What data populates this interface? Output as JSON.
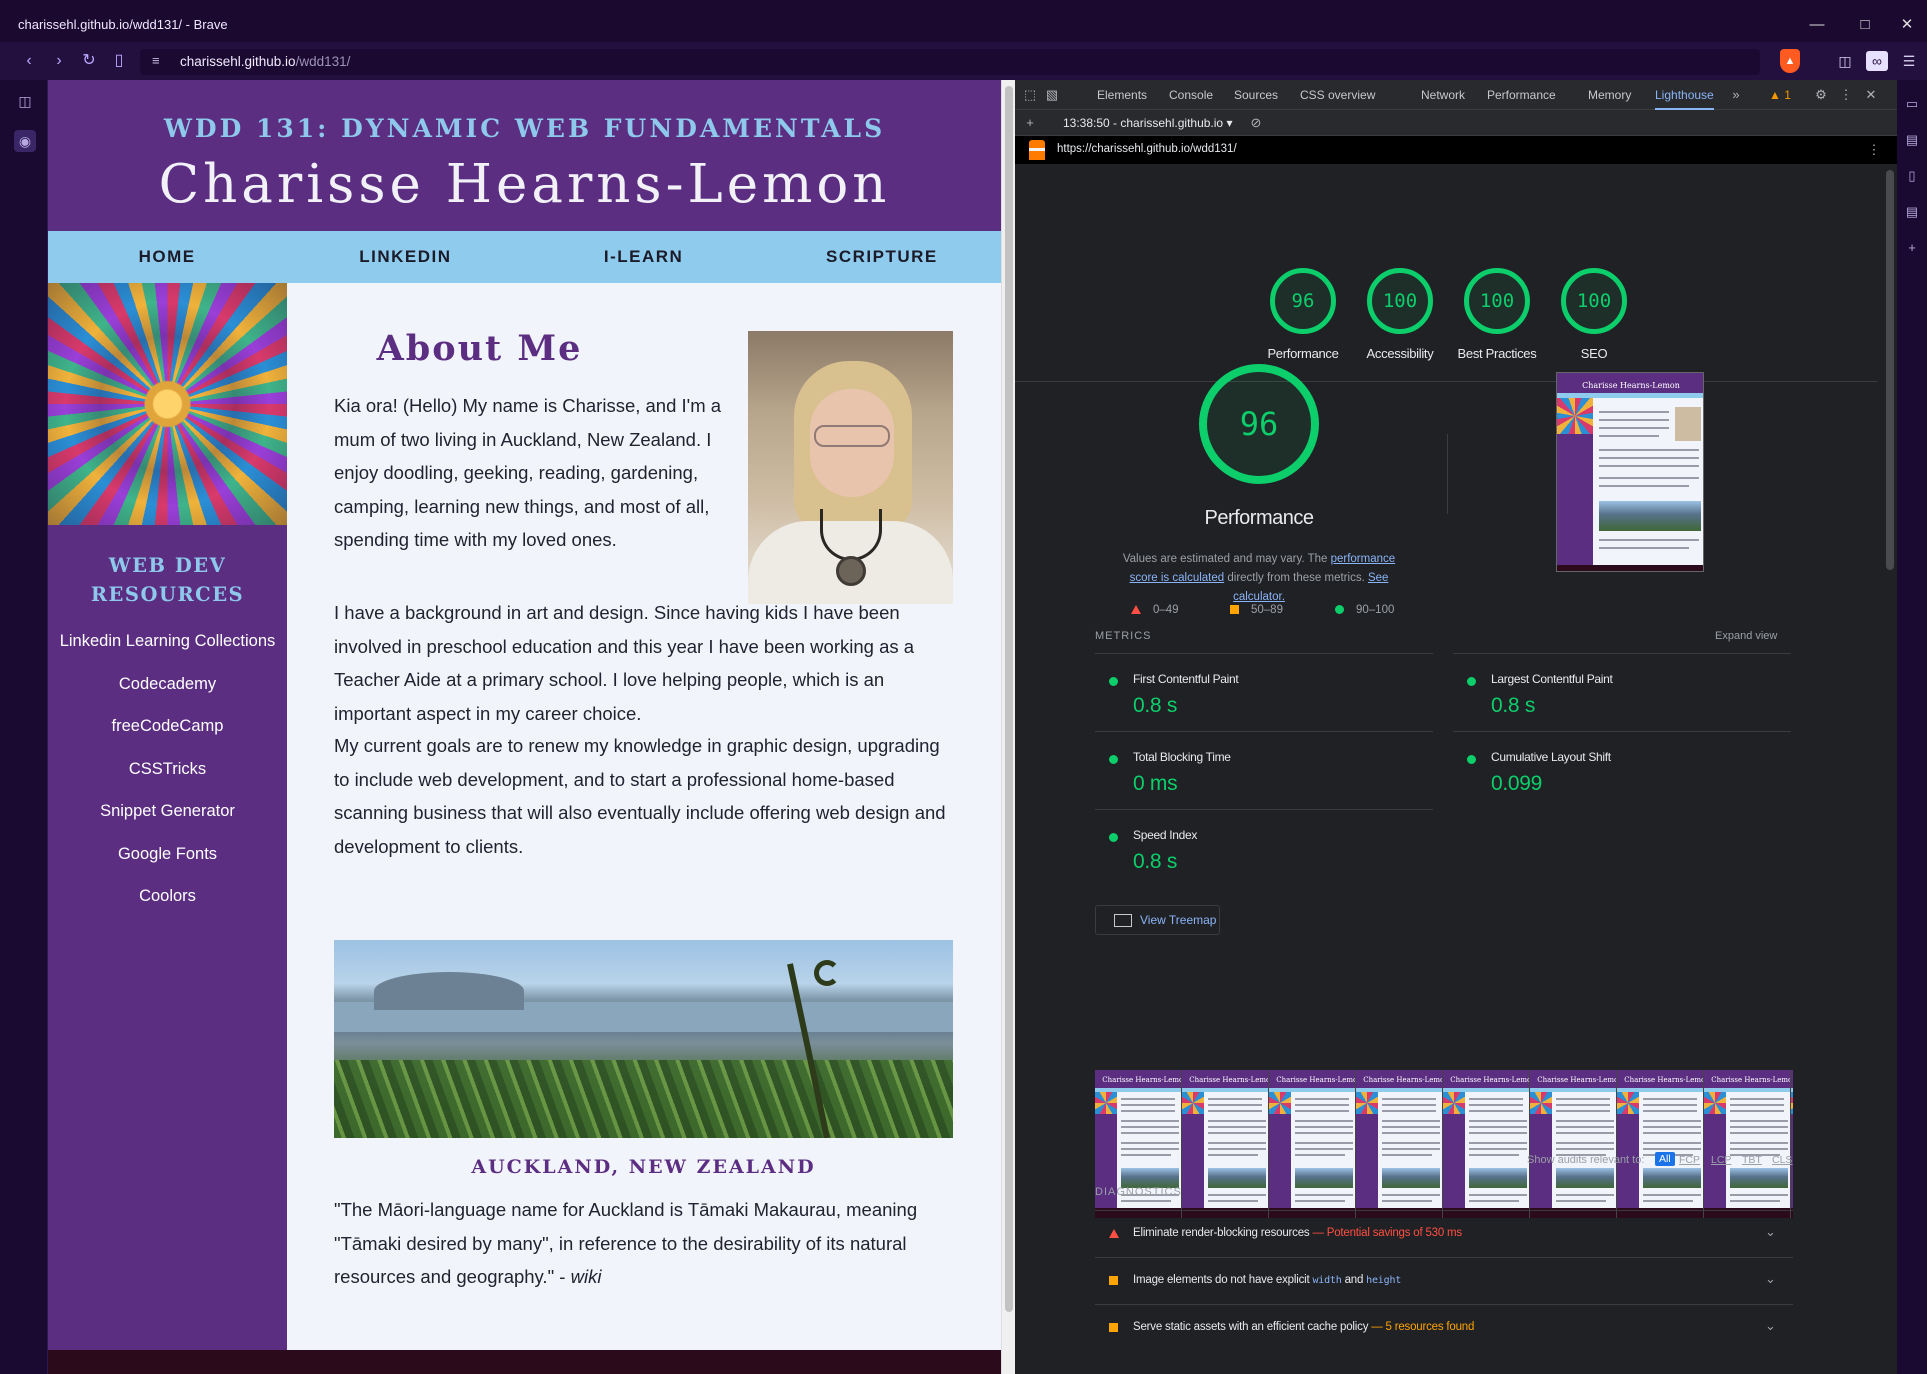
{
  "window": {
    "title": "charissehl.github.io/wdd131/ - Brave",
    "url_host": "charissehl.github.io",
    "url_path": "/wdd131/"
  },
  "site": {
    "subtitle": "WDD 131: DYNAMIC WEB FUNDAMENTALS",
    "name": "Charisse Hearns-Lemon",
    "nav": [
      "HOME",
      "LINKEDIN",
      "I-LEARN",
      "SCRIPTURE"
    ],
    "resources_title_line1": "WEB DEV",
    "resources_title_line2": "RESOURCES",
    "resources": [
      "Linkedin Learning Collections",
      "Codecademy",
      "freeCodeCamp",
      "CSSTricks",
      "Snippet Generator",
      "Google Fonts",
      "Coolors"
    ],
    "about_title": "About Me",
    "paragraphs": [
      "Kia ora! (Hello) My name is Charisse, and I'm a mum of two living in Auckland, New Zealand. I enjoy doodling, geeking, reading, gardening, camping, learning new things, and most of all, spending time with my loved ones.",
      "I have a background in art and design. Since having kids I have been involved in preschool education and this year I have been working as a Teacher Aide at a primary school. I love helping people, which is an important aspect in my career choice.",
      "My current goals are to renew my knowledge in graphic design, upgrading to include web development, and to start a professional home-based scanning business that will also eventually include offering web design and development to clients."
    ],
    "caption": "AUCKLAND, NEW ZEALAND",
    "quote": "\"The Māori-language name for Auckland is Tāmaki Makaurau, meaning \"Tāmaki desired by many\", in reference to the desirability of its natural resources and geography.\" - ",
    "quote_source": "wiki"
  },
  "devtools": {
    "tabs": [
      "Elements",
      "Console",
      "Sources",
      "CSS overview",
      "Network",
      "Performance",
      "Memory",
      "Lighthouse"
    ],
    "active_tab": "Lighthouse",
    "warning_count": "1",
    "report_select": "13:38:50 - charissehl.github.io",
    "report_url": "https://charissehl.github.io/wdd131/",
    "scores": [
      {
        "label": "Performance",
        "value": "96"
      },
      {
        "label": "Accessibility",
        "value": "100"
      },
      {
        "label": "Best Practices",
        "value": "100"
      },
      {
        "label": "SEO",
        "value": "100"
      }
    ],
    "main_score": "96",
    "main_label": "Performance",
    "note_prefix": "Values are estimated and may vary. The ",
    "note_link1": "performance score is calculated",
    "note_mid": " directly from these metrics. ",
    "note_link2": "See calculator.",
    "legend": [
      "0–49",
      "50–89",
      "90–100"
    ],
    "metrics_heading": "METRICS",
    "expand_view": "Expand view",
    "metrics": [
      {
        "name": "First Contentful Paint",
        "value": "0.8 s"
      },
      {
        "name": "Largest Contentful Paint",
        "value": "0.8 s"
      },
      {
        "name": "Total Blocking Time",
        "value": "0 ms"
      },
      {
        "name": "Cumulative Layout Shift",
        "value": "0.099"
      },
      {
        "name": "Speed Index",
        "value": "0.8 s"
      }
    ],
    "treemap": "View Treemap",
    "show_audits": "Show audits relevant to:",
    "filters": [
      "All",
      "FCP",
      "LCP",
      "TBT",
      "CLS"
    ],
    "diagnostics_heading": "DIAGNOSTICS",
    "diagnostics": [
      {
        "text": "Eliminate render-blocking resources",
        "detail": " — Potential savings of 530 ms"
      },
      {
        "text_a": "Image elements do not have explicit ",
        "code1": "width",
        "text_b": " and ",
        "code2": "height"
      },
      {
        "text": "Serve static assets with an efficient cache policy",
        "detail": " — 5 resources found"
      }
    ],
    "colors": {
      "pass": "#0cce6b",
      "average": "#ffa400",
      "fail": "#ff4e42",
      "accent": "#8ab4f8"
    }
  },
  "colors": {
    "purple": "#5b2e82",
    "nav_blue": "#8ecbec"
  }
}
